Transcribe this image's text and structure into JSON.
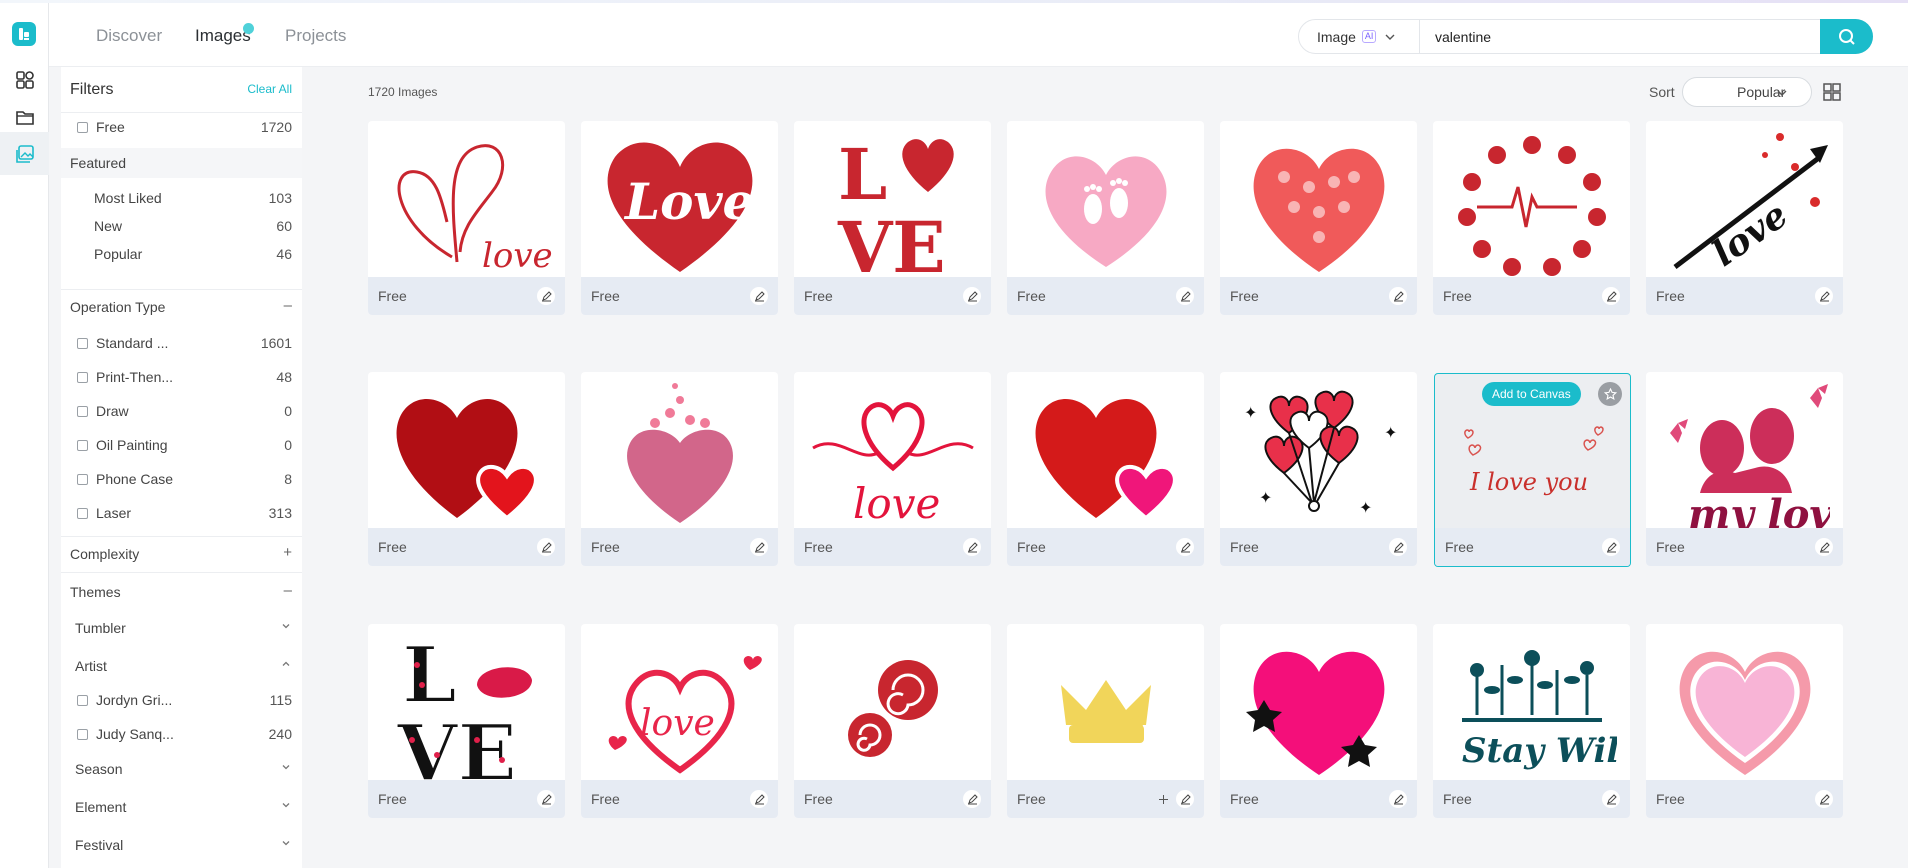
{
  "nav": {
    "tabs": [
      {
        "label": "Discover"
      },
      {
        "label": "Images"
      },
      {
        "label": "Projects"
      }
    ]
  },
  "search": {
    "type_label": "Image",
    "ai_badge": "AI",
    "value": "valentine"
  },
  "filters": {
    "title": "Filters",
    "clear_all": "Clear All",
    "free": {
      "label": "Free",
      "count": "1720"
    },
    "featured": {
      "label": "Featured",
      "items": [
        {
          "label": "Most Liked",
          "count": "103"
        },
        {
          "label": "New",
          "count": "60"
        },
        {
          "label": "Popular",
          "count": "46"
        }
      ]
    },
    "operation_type": {
      "label": "Operation Type",
      "toggle": "–",
      "items": [
        {
          "label": "Standard ...",
          "count": "1601"
        },
        {
          "label": "Print-Then...",
          "count": "48"
        },
        {
          "label": "Draw",
          "count": "0"
        },
        {
          "label": "Oil Painting",
          "count": "0"
        },
        {
          "label": "Phone Case",
          "count": "8"
        },
        {
          "label": "Laser",
          "count": "313"
        }
      ]
    },
    "complexity": {
      "label": "Complexity",
      "toggle": "+"
    },
    "themes": {
      "label": "Themes",
      "toggle": "–",
      "tumbler": "Tumbler",
      "artist": "Artist",
      "artists": [
        {
          "label": "Jordyn Gri...",
          "count": "115"
        },
        {
          "label": "Judy Sanq...",
          "count": "240"
        }
      ],
      "season": "Season",
      "element": "Element",
      "festival": "Festival"
    }
  },
  "results": {
    "count_label": "1720 Images",
    "sort_label": "Sort",
    "sort_value": "Popular",
    "card_label": "Free",
    "add_to_canvas": "Add to Canvas"
  },
  "card_texts": {
    "c1": "love",
    "c2": "Love",
    "c3a": "L",
    "c3b": "VE",
    "c10": "love",
    "c13": "I love you",
    "c14": "my love",
    "c15a": "L",
    "c15b": "VE",
    "c16": "love",
    "c20": "Stay Wild"
  },
  "colors": {
    "accent": "#1bbccb",
    "heart_red": "#d02a2a",
    "pink": "#f7a9c4"
  }
}
